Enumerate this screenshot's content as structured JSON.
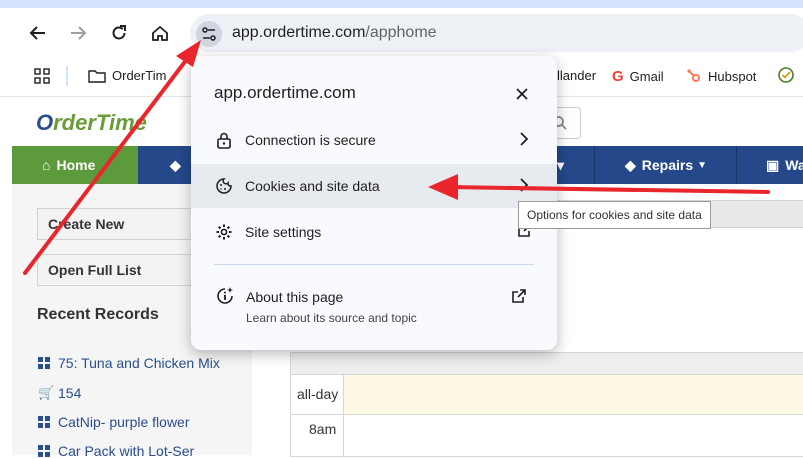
{
  "browser": {
    "url_host": "app.ordertime.com",
    "url_path": "/apphome",
    "bookmarks": [
      {
        "label": "OrderTim",
        "icon": "folder-icon"
      },
      {
        "label": "llander",
        "icon": ""
      },
      {
        "label": "Gmail",
        "icon": "google-icon"
      },
      {
        "label": "Hubspot",
        "icon": "hubspot-icon"
      }
    ]
  },
  "app": {
    "logo_prefix": "O",
    "logo_rest": "rderTime",
    "nav": {
      "home": "Home",
      "repairs": "Repairs",
      "warehouse_partial": "Wa"
    },
    "sidebar": {
      "create_new": "Create New",
      "open_full_list": "Open Full List",
      "recent_title": "Recent Records",
      "recent": [
        {
          "label": "75: Tuna and Chicken Mix",
          "icon": "grid-icon"
        },
        {
          "label": "154",
          "icon": "cart-icon"
        },
        {
          "label": "CatNip- purple flower",
          "icon": "grid-icon"
        },
        {
          "label": "Car Pack with Lot-Ser",
          "icon": "grid-icon"
        }
      ]
    },
    "calendar": {
      "allday_label": "all-day",
      "time_8am": "8am"
    }
  },
  "popup": {
    "title": "app.ordertime.com",
    "rows": [
      {
        "label": "Connection is secure",
        "icon": "lock-icon"
      },
      {
        "label": "Cookies and site data",
        "icon": "cookie-icon"
      },
      {
        "label": "Site settings",
        "icon": "gear-icon"
      }
    ],
    "about_title": "About this page",
    "about_subtitle": "Learn about its source and topic",
    "tooltip": "Options for cookies and site data"
  },
  "colors": {
    "annotation_arrow": "#e8262b",
    "nav_blue": "#24488a",
    "nav_green": "#5d9a3c"
  }
}
